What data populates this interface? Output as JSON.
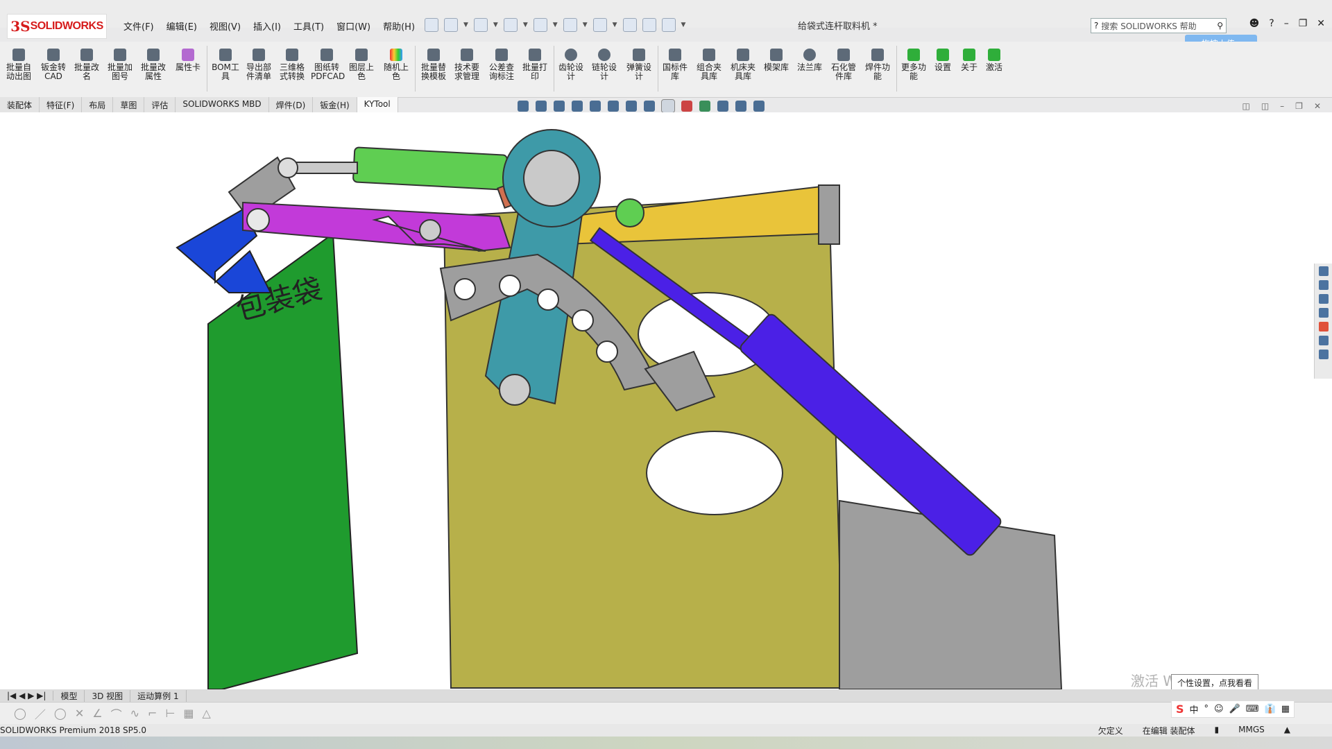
{
  "app": {
    "logo_prefix": "3S",
    "logo_name": "SOLIDWORKS",
    "doc_title": "给袋式连杆取料机 *",
    "search_placeholder": "搜索 SOLIDWORKS 帮助",
    "upload_label": "拖拽上传"
  },
  "menu": [
    "文件(F)",
    "编辑(E)",
    "视图(V)",
    "插入(I)",
    "工具(T)",
    "窗口(W)",
    "帮助(H)"
  ],
  "ribbon": [
    "批量自\n动出图",
    "钣金转\nCAD",
    "批量改\n名",
    "批量加\n图号",
    "批量改\n属性",
    "属性卡",
    "BOM工\n具",
    "导出部\n件清单",
    "三维格\n式转换",
    "图纸转\nPDFCAD",
    "图层上\n色",
    "随机上\n色",
    "批量替\n换模板",
    "技术要\n求管理",
    "公差查\n询标注",
    "批量打\n印",
    "齿轮设\n计",
    "链轮设\n计",
    "弹簧设\n计",
    "国标件\n库",
    "组合夹\n具库",
    "机床夹\n具库",
    "模架库",
    "法兰库",
    "石化管\n件库",
    "焊件功\n能",
    "更多功\n能",
    "设置",
    "关于",
    "激活"
  ],
  "tabs": [
    "装配体",
    "特征(F)",
    "布局",
    "草图",
    "评估",
    "SOLIDWORKS MBD",
    "焊件(D)",
    "钣金(H)",
    "KYTool"
  ],
  "active_tab": "KYTool",
  "viewport": {
    "bag_label": "包装袋",
    "colors": {
      "bag": "#1f9b2e",
      "frame": "#b7b04a",
      "rail": "#e9c43a",
      "link": "#3e9aa8",
      "purple_arm": "#c23ad9",
      "blue_cylinder": "#4b20e6",
      "green_cylinder": "#5fce52",
      "gray_bracket": "#9e9e9e",
      "blue_blade": "#1a46d8",
      "copper_shaft": "#d07050"
    }
  },
  "bottom_tabs": [
    "模型",
    "3D 视图",
    "运动算例 1"
  ],
  "status": {
    "left": "SOLIDWORKS Premium 2018 SP5.0",
    "undefined": "欠定义",
    "editing": "在编辑 装配体",
    "units": "MMGS"
  },
  "overlay": {
    "watermark": "激活 Windows",
    "tooltip": "个性设置，点我看看",
    "ime_label": "中"
  }
}
